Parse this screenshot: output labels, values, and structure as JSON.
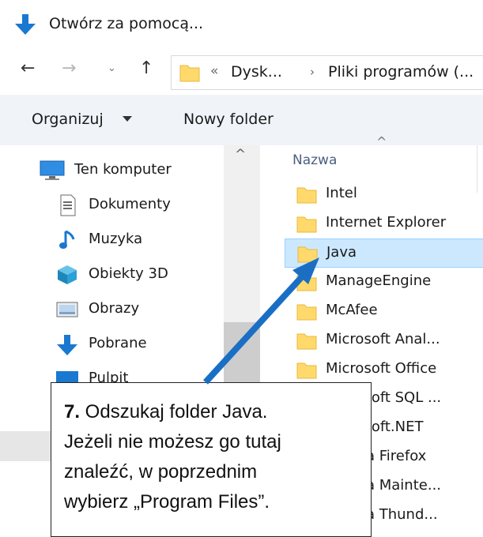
{
  "title": {
    "text": "Otwórz za pomocą..."
  },
  "address": {
    "chevron": "«",
    "segment1": "Dysk...",
    "separator": "›",
    "segment2": "Pliki programów (..."
  },
  "toolbar": {
    "organize": "Organizuj",
    "new_folder": "Nowy folder"
  },
  "nav": {
    "items": [
      {
        "label": "Ten komputer",
        "icon": "computer-icon"
      },
      {
        "label": "Dokumenty",
        "icon": "document-icon"
      },
      {
        "label": "Muzyka",
        "icon": "music-note-icon"
      },
      {
        "label": "Obiekty 3D",
        "icon": "cube-3d-icon"
      },
      {
        "label": "Obrazy",
        "icon": "pictures-icon"
      },
      {
        "label": "Pobrane",
        "icon": "download-arrow-icon"
      },
      {
        "label": "Pulpit",
        "icon": "desktop-icon"
      }
    ]
  },
  "files": {
    "column_header": "Nazwa",
    "items": [
      {
        "label": "Intel"
      },
      {
        "label": "Internet Explorer"
      },
      {
        "label": "Java",
        "selected": true
      },
      {
        "label": "ManageEngine"
      },
      {
        "label": "McAfee"
      },
      {
        "label": "Microsoft Anal..."
      },
      {
        "label": "Microsoft Office"
      },
      {
        "label": "Microsoft SQL ..."
      },
      {
        "label": "Microsoft.NET"
      },
      {
        "label": "Mozilla Firefox"
      },
      {
        "label": "Mozilla Mainte..."
      },
      {
        "label": "Mozilla Thund..."
      }
    ]
  },
  "callout": {
    "step": "7.",
    "line1": " Odszukaj folder Java.",
    "line2": "Jeżeli nie możesz go tutaj",
    "line3": "znaleźć, w poprzednim",
    "line4": "wybierz „Program Files”."
  },
  "colors": {
    "accent": "#1a78d0",
    "arrow": "#1a6fc4",
    "folder": "#ffd96b",
    "selection": "#cce8ff",
    "toolbar": "#f0f4f9"
  }
}
